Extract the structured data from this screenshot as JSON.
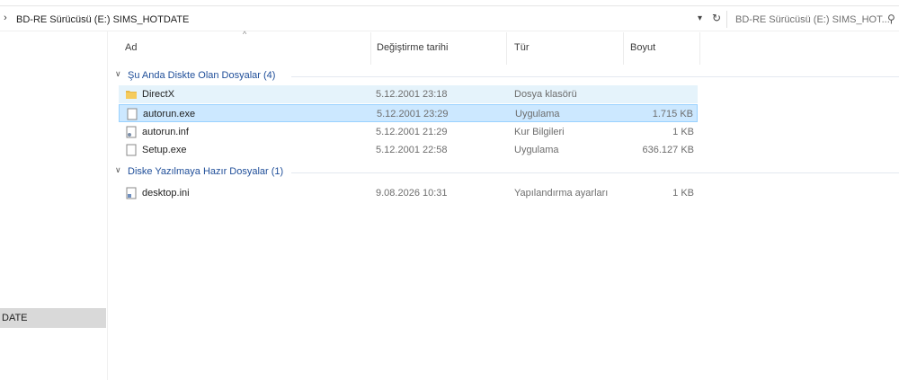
{
  "address": {
    "path": "BD-RE Sürücüsü (E:) SIMS_HOTDATE",
    "search_placeholder": "BD-RE Sürücüsü (E:) SIMS_HOT...",
    "chevron_icon": "chevron-right-icon",
    "dropdown_icon": "chevron-down-icon",
    "refresh_icon": "refresh-icon",
    "search_icon": "search-icon"
  },
  "nav": {
    "selected_label": "DATE"
  },
  "columns": {
    "name": "Ad",
    "date": "Değiştirme tarihi",
    "type": "Tür",
    "size": "Boyut"
  },
  "groups": [
    {
      "label": "Şu Anda Diskte Olan Dosyalar (4)",
      "files": [
        {
          "name": "DirectX",
          "date": "5.12.2001 23:18",
          "type": "Dosya klasörü",
          "size": "",
          "icon": "folder-icon",
          "state": "hover"
        },
        {
          "name": "autorun.exe",
          "date": "5.12.2001 23:29",
          "type": "Uygulama",
          "size": "1.715 KB",
          "icon": "exe-file-icon",
          "state": "selected"
        },
        {
          "name": "autorun.inf",
          "date": "5.12.2001 21:29",
          "type": "Kur Bilgileri",
          "size": "1 KB",
          "icon": "inf-file-icon",
          "state": ""
        },
        {
          "name": "Setup.exe",
          "date": "5.12.2001 22:58",
          "type": "Uygulama",
          "size": "636.127 KB",
          "icon": "exe-file-icon",
          "state": ""
        }
      ]
    },
    {
      "label": "Diske Yazılmaya Hazır Dosyalar (1)",
      "files": [
        {
          "name": "desktop.ini",
          "date": "9.08.2026 10:31",
          "type": "Yapılandırma ayarları",
          "size": "1 KB",
          "icon": "ini-file-icon",
          "state": ""
        }
      ]
    }
  ],
  "colors": {
    "selection": "#cce8ff",
    "hover": "#e5f3fb",
    "group_text": "#1f4e99"
  }
}
